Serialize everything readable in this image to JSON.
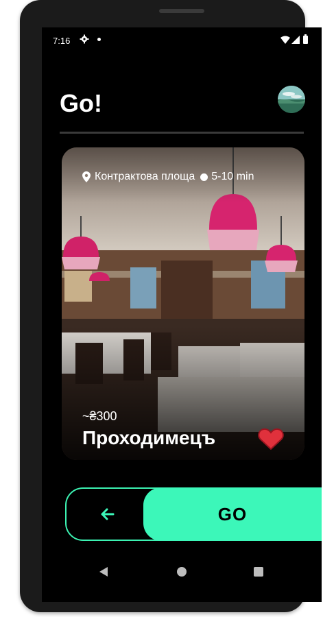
{
  "status_bar": {
    "time": "7:16",
    "icons": [
      "gear-icon",
      "dot-icon",
      "wifi-icon",
      "signal-icon",
      "battery-icon"
    ]
  },
  "header": {
    "title": "Go!",
    "avatar_icon": "avatar"
  },
  "card": {
    "location": "Контрактова площа",
    "duration": "5-10 min",
    "price": "~₴300",
    "name": "Проходимецъ",
    "favorite": true
  },
  "swipe": {
    "back_icon": "back-arrow-icon",
    "go_label": "GO"
  },
  "nav": {
    "icons": [
      "nav-back-icon",
      "nav-home-icon",
      "nav-recents-icon"
    ]
  },
  "colors": {
    "accent": "#3cf7b9",
    "heart": "#e0313c",
    "background": "#000000"
  }
}
